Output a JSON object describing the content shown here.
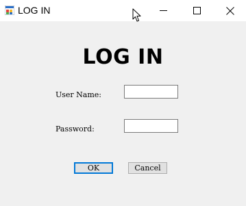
{
  "window": {
    "title": "LOG IN",
    "icon": "windows-forms-app-icon",
    "controls": {
      "minimize_icon": "minimize-icon",
      "maximize_icon": "maximize-icon",
      "close_icon": "close-icon"
    }
  },
  "form": {
    "heading": "LOG IN",
    "username_label": "User Name:",
    "username_value": "",
    "password_label": "Password:",
    "password_value": ""
  },
  "buttons": {
    "ok_label": "OK",
    "cancel_label": "Cancel"
  },
  "colors": {
    "focus_accent": "#0078d7",
    "window_bg": "#f0f0f0",
    "titlebar_bg": "#ffffff"
  }
}
